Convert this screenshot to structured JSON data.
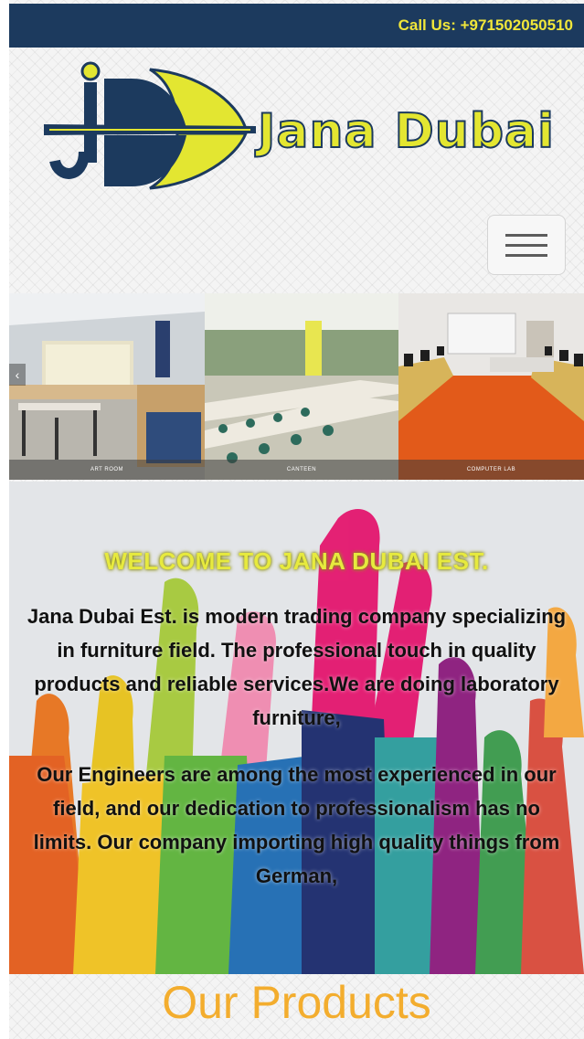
{
  "topbar": {
    "call_text": "Call Us: +971502050510"
  },
  "brand": {
    "name": "Jana Dubai",
    "logo_icon": "jana-dubai-logo-icon"
  },
  "nav": {
    "menu_icon": "hamburger-menu-icon"
  },
  "slider": {
    "prev_icon": "chevron-left-icon",
    "prev_glyph": "‹",
    "slides": [
      {
        "caption": "ART ROOM"
      },
      {
        "caption": "CANTEEN"
      },
      {
        "caption": "COMPUTER LAB"
      }
    ]
  },
  "welcome": {
    "title": "WELCOME TO JANA DUBAI EST.",
    "paragraph1": "Jana Dubai Est. is modern trading company specializing in furniture field. The professional touch in quality products and reliable services.We are doing laboratory furniture,",
    "paragraph2": "Our Engineers are among the most experienced in our field, and our dedication to professionalism has no limits. Our company importing high quality things from German,"
  },
  "products": {
    "title": "Our Products"
  },
  "colors": {
    "topbar_bg": "#1c3a5e",
    "accent_yellow": "#e3e631",
    "products_orange": "#f3ad2e",
    "navy": "#1c3a5e"
  }
}
